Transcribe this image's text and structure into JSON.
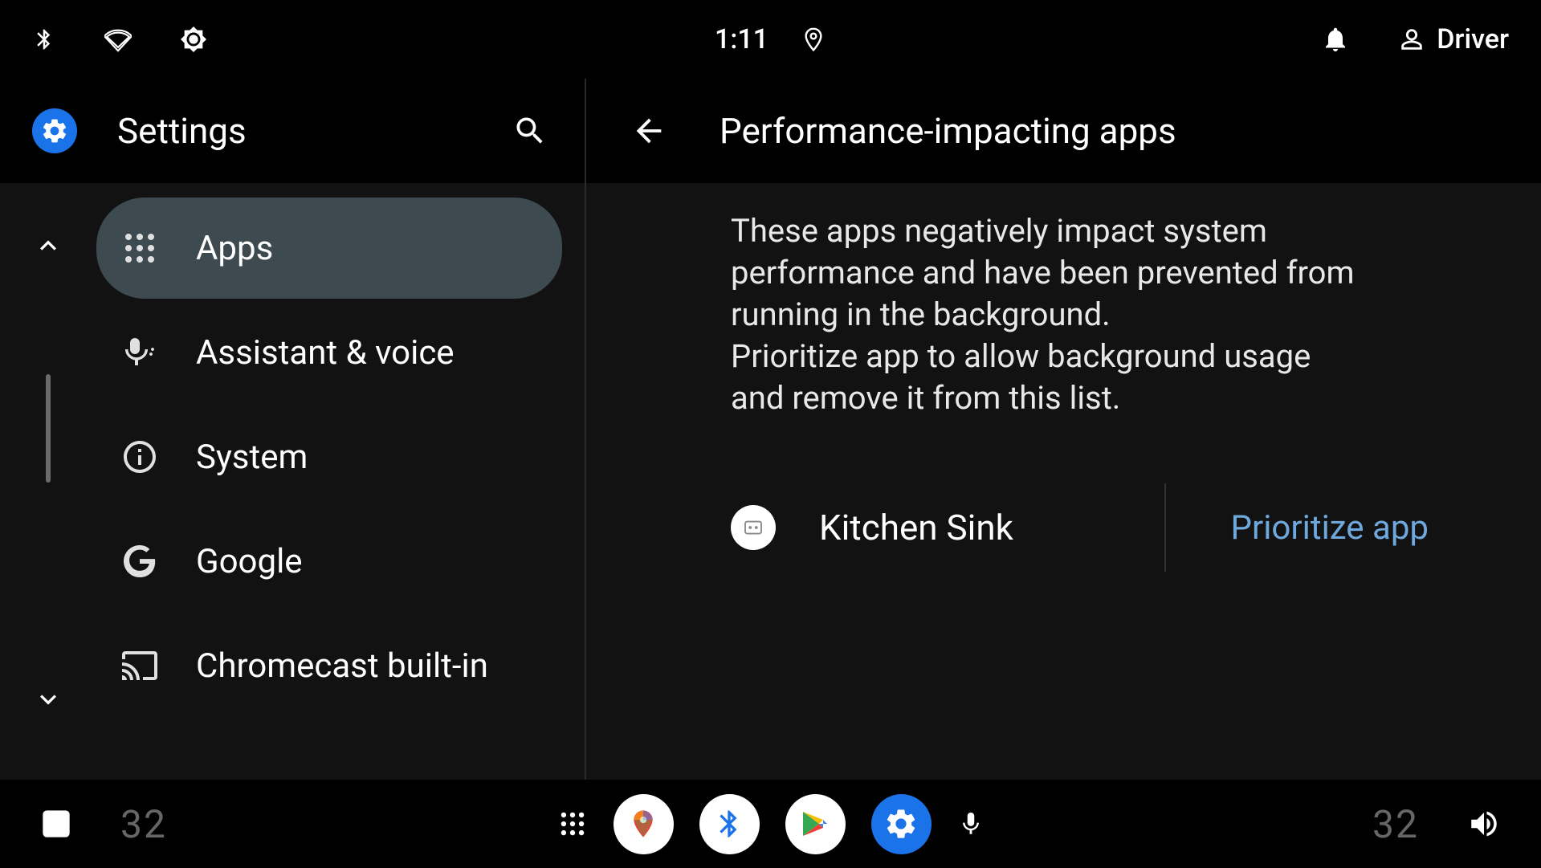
{
  "status": {
    "time": "1:11",
    "driver_label": "Driver"
  },
  "sidebar": {
    "title": "Settings",
    "items": [
      {
        "label": "Apps",
        "icon": "apps-grid"
      },
      {
        "label": "Assistant & voice",
        "icon": "assistant"
      },
      {
        "label": "System",
        "icon": "info"
      },
      {
        "label": "Google",
        "icon": "google-g"
      },
      {
        "label": "Chromecast built-in",
        "icon": "cast"
      }
    ],
    "active_index": 0
  },
  "detail": {
    "title": "Performance-impacting apps",
    "description_line1": "These apps negatively impact system performance and have been prevented from running in the background.",
    "description_line2": "Prioritize app to allow background usage and remove it from this list.",
    "apps": [
      {
        "name": "Kitchen Sink",
        "action_label": "Prioritize app"
      }
    ]
  },
  "dock": {
    "temp_left": "32",
    "temp_right": "32"
  }
}
